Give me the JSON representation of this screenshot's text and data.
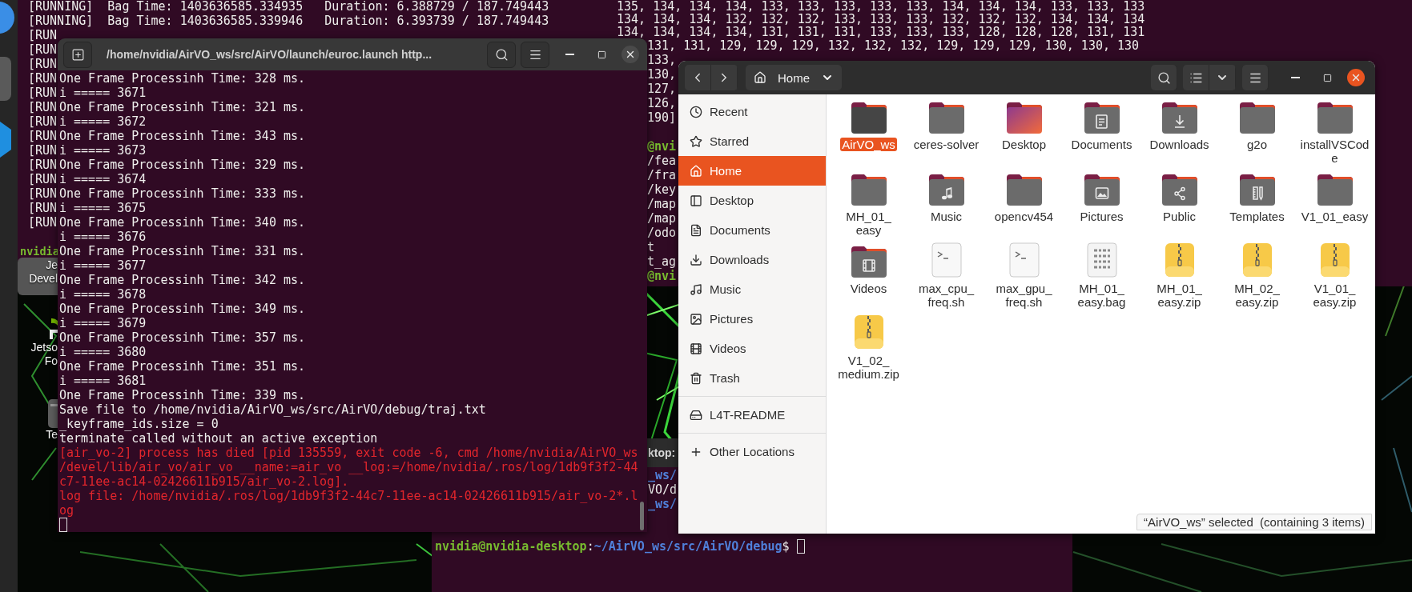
{
  "desktop_icons": [
    {
      "kind": "text",
      "label_lines": [
        "Je",
        "Devel"
      ],
      "selected": true
    },
    {
      "kind": "logo",
      "label_lines": [
        "Jetso",
        "Fo"
      ],
      "selected": false
    },
    {
      "kind": "app",
      "label_lines": [
        "Te"
      ],
      "selected": false
    }
  ],
  "terminal_back_left": {
    "lines": [
      {
        "kind": "output",
        "text": "[RUNNING]  Bag Time: 1403636585.334935   Duration: 6.388729 / 187.749443"
      },
      {
        "kind": "output",
        "text": "[RUNNING]  Bag Time: 1403636585.339946   Duration: 6.393739 / 187.749443"
      },
      {
        "kind": "output",
        "text": "[RUN"
      },
      {
        "kind": "output",
        "text": "[RUN"
      },
      {
        "kind": "output",
        "text": "[RUN"
      },
      {
        "kind": "output",
        "text": "[RUN"
      },
      {
        "kind": "output",
        "text": "[RUN"
      },
      {
        "kind": "output",
        "text": "[RUN"
      },
      {
        "kind": "output",
        "text": "[RUN"
      },
      {
        "kind": "output",
        "text": "[RUN"
      },
      {
        "kind": "output",
        "text": "[RUN"
      },
      {
        "kind": "output",
        "text": "[RUN"
      },
      {
        "kind": "output",
        "text": "[RUN"
      },
      {
        "kind": "output",
        "text": "[RUN"
      },
      {
        "kind": "output",
        "text": "[RUN"
      },
      {
        "kind": "output",
        "text": "[RUN"
      }
    ],
    "prompt": "nvidia"
  },
  "terminal_back_right": {
    "data_lines": [
      {
        "kind": "full",
        "text": "135, 134, 134, 134, 133, 133, 133, 133, 133, 134, 134, 134, 133, 133, 133"
      },
      {
        "kind": "full",
        "text": "134, 134, 134, 132, 132, 132, 133, 133, 133, 132, 132, 132, 134, 134, 134"
      },
      {
        "kind": "full",
        "text": "134, 134, 134, 134, 131, 131, 131, 133, 133, 133, 128, 128, 128, 131, 131"
      },
      {
        "kind": "tail",
        "text": "131, 131, 129, 129, 129, 132, 132, 132, 129, 129, 129, 130, 130, 130"
      },
      {
        "kind": "tail",
        "text": "133,"
      },
      {
        "kind": "tail",
        "text": "130,"
      },
      {
        "kind": "tail",
        "text": "127,"
      },
      {
        "kind": "tail",
        "text": "126,"
      },
      {
        "kind": "tail",
        "text": "190]"
      }
    ],
    "command_lines": [
      {
        "kind": "prompt",
        "text": "@nvi"
      },
      {
        "kind": "output",
        "text": "/fea"
      },
      {
        "kind": "output",
        "text": "/fra"
      },
      {
        "kind": "output",
        "text": "/key"
      },
      {
        "kind": "output",
        "text": "/map"
      },
      {
        "kind": "output",
        "text": "/map"
      },
      {
        "kind": "output",
        "text": "/odo"
      },
      {
        "kind": "output",
        "text": "t"
      },
      {
        "kind": "output",
        "text": "t_ag"
      },
      {
        "kind": "prompt",
        "text": "@nvi"
      }
    ]
  },
  "terminal_bottom": {
    "title": "ktop:",
    "lines": [
      {
        "kind": "path",
        "text": "_ws/"
      },
      {
        "kind": "output",
        "text": "VO/d"
      },
      {
        "kind": "path",
        "text": "_ws/"
      }
    ],
    "prompt": [
      {
        "kind": "prompt",
        "text": "nvidia@nvidia-desktop"
      },
      {
        "kind": "output",
        "text": ":"
      },
      {
        "kind": "path",
        "text": "~/AirVO_ws/src/AirVO/debug"
      },
      {
        "kind": "output",
        "text": "$"
      }
    ]
  },
  "terminal_front": {
    "title": "/home/nvidia/AirVO_ws/src/AirVO/launch/euroc.launch http...",
    "lines": [
      {
        "kind": "output",
        "text": "One Frame Processinh Time: 328 ms."
      },
      {
        "kind": "output",
        "text": "i ===== 3671"
      },
      {
        "kind": "output",
        "text": "One Frame Processinh Time: 321 ms."
      },
      {
        "kind": "output",
        "text": "i ===== 3672"
      },
      {
        "kind": "output",
        "text": "One Frame Processinh Time: 343 ms."
      },
      {
        "kind": "output",
        "text": "i ===== 3673"
      },
      {
        "kind": "output",
        "text": "One Frame Processinh Time: 329 ms."
      },
      {
        "kind": "output",
        "text": "i ===== 3674"
      },
      {
        "kind": "output",
        "text": "One Frame Processinh Time: 333 ms."
      },
      {
        "kind": "output",
        "text": "i ===== 3675"
      },
      {
        "kind": "output",
        "text": "One Frame Processinh Time: 340 ms."
      },
      {
        "kind": "output",
        "text": "i ===== 3676"
      },
      {
        "kind": "output",
        "text": "One Frame Processinh Time: 331 ms."
      },
      {
        "kind": "output",
        "text": "i ===== 3677"
      },
      {
        "kind": "output",
        "text": "One Frame Processinh Time: 342 ms."
      },
      {
        "kind": "output",
        "text": "i ===== 3678"
      },
      {
        "kind": "output",
        "text": "One Frame Processinh Time: 349 ms."
      },
      {
        "kind": "output",
        "text": "i ===== 3679"
      },
      {
        "kind": "output",
        "text": "One Frame Processinh Time: 357 ms."
      },
      {
        "kind": "output",
        "text": "i ===== 3680"
      },
      {
        "kind": "output",
        "text": "One Frame Processinh Time: 351 ms."
      },
      {
        "kind": "output",
        "text": "i ===== 3681"
      },
      {
        "kind": "output",
        "text": "One Frame Processinh Time: 339 ms."
      },
      {
        "kind": "output",
        "text": "Save file to /home/nvidia/AirVO_ws/src/AirVO/debug/traj.txt"
      },
      {
        "kind": "output",
        "text": "_keyframe_ids.size = 0"
      },
      {
        "kind": "output",
        "text": "terminate called without an active exception"
      },
      {
        "kind": "error",
        "text": "[air_vo-2] process has died [pid 135559, exit code -6, cmd /home/nvidia/AirVO_ws"
      },
      {
        "kind": "error",
        "text": "/devel/lib/air_vo/air_vo __name:=air_vo __log:=/home/nvidia/.ros/log/1db9f3f2-44"
      },
      {
        "kind": "error",
        "text": "c7-11ee-ac14-02426611b915/air_vo-2.log]."
      },
      {
        "kind": "error",
        "text": "log file: /home/nvidia/.ros/log/1db9f3f2-44c7-11ee-ac14-02426611b915/air_vo-2*.l"
      },
      {
        "kind": "error",
        "text": "og"
      }
    ]
  },
  "file_manager": {
    "location": "Home",
    "sidebar": {
      "places": [
        {
          "kind": "recent",
          "label": "Recent",
          "selected": false
        },
        {
          "kind": "starred",
          "label": "Starred",
          "selected": false
        },
        {
          "kind": "home",
          "label": "Home",
          "selected": true
        },
        {
          "kind": "desktop",
          "label": "Desktop",
          "selected": false
        },
        {
          "kind": "documents",
          "label": "Documents",
          "selected": false
        },
        {
          "kind": "downloads",
          "label": "Downloads",
          "selected": false
        },
        {
          "kind": "music",
          "label": "Music",
          "selected": false
        },
        {
          "kind": "pictures",
          "label": "Pictures",
          "selected": false
        },
        {
          "kind": "videos",
          "label": "Videos",
          "selected": false
        },
        {
          "kind": "trash",
          "label": "Trash",
          "selected": false
        }
      ],
      "devices": [
        {
          "kind": "drive",
          "label": "L4T-README",
          "selected": false
        }
      ],
      "other": [
        {
          "kind": "other",
          "label": "Other Locations",
          "selected": false
        }
      ]
    },
    "items": [
      {
        "kind": "folder",
        "name": "AirVO_ws",
        "selected": true
      },
      {
        "kind": "folder",
        "name": "ceres-solver",
        "selected": false
      },
      {
        "kind": "desktop",
        "name": "Desktop",
        "selected": false
      },
      {
        "kind": "documents",
        "name": "Documents",
        "selected": false
      },
      {
        "kind": "downloads",
        "name": "Downloads",
        "selected": false
      },
      {
        "kind": "folder",
        "name": "g2o",
        "selected": false
      },
      {
        "kind": "folder",
        "name": "installVSCode",
        "selected": false
      },
      {
        "kind": "folder",
        "name": "MH_01_easy",
        "selected": false
      },
      {
        "kind": "music",
        "name": "Music",
        "selected": false
      },
      {
        "kind": "folder",
        "name": "opencv454",
        "selected": false
      },
      {
        "kind": "pictures",
        "name": "Pictures",
        "selected": false
      },
      {
        "kind": "public",
        "name": "Public",
        "selected": false
      },
      {
        "kind": "templates",
        "name": "Templates",
        "selected": false
      },
      {
        "kind": "folder",
        "name": "V1_01_easy",
        "selected": false
      },
      {
        "kind": "videos",
        "name": "Videos",
        "selected": false
      },
      {
        "kind": "script",
        "name": "max_cpu_freq.sh",
        "selected": false
      },
      {
        "kind": "script",
        "name": "max_gpu_freq.sh",
        "selected": false
      },
      {
        "kind": "data",
        "name": "MH_01_easy.bag",
        "selected": false
      },
      {
        "kind": "archive",
        "name": "MH_01_easy.zip",
        "selected": false
      },
      {
        "kind": "archive",
        "name": "MH_02_easy.zip",
        "selected": false
      },
      {
        "kind": "archive",
        "name": "V1_01_easy.zip",
        "selected": false
      },
      {
        "kind": "archive",
        "name": "V1_02_medium.zip",
        "selected": false
      }
    ],
    "status": "“AirVO_ws” selected  (containing 3 items)"
  }
}
